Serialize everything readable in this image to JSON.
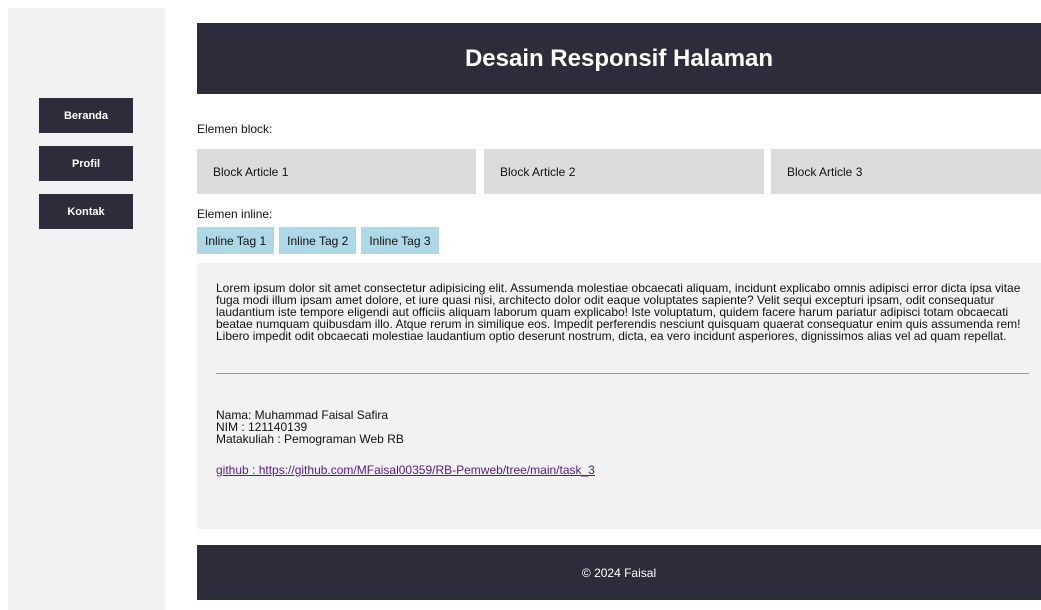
{
  "sidebar": {
    "items": [
      {
        "label": "Beranda"
      },
      {
        "label": "Profil"
      },
      {
        "label": "Kontak"
      }
    ]
  },
  "header": {
    "title": "Desain Responsif Halaman"
  },
  "block_section": {
    "label": "Elemen block:",
    "articles": [
      "Block Article 1",
      "Block Article 2",
      "Block Article 3"
    ]
  },
  "inline_section": {
    "label": "Elemen inline:",
    "tags": [
      "Inline Tag 1",
      "Inline Tag 2",
      "Inline Tag 3"
    ]
  },
  "content": {
    "paragraph": "Lorem ipsum dolor sit amet consectetur adipisicing elit. Assumenda molestiae obcaecati aliquam, incidunt explicabo omnis adipisci error dicta ipsa vitae fuga modi illum ipsam amet dolore, et iure quasi nisi, architecto dolor odit eaque voluptates sapiente? Velit sequi excepturi ipsam, odit consequatur laudantium iste tempore eligendi aut officiis aliquam laborum quam explicabo! Iste voluptatum, quidem facere harum pariatur adipisci totam obcaecati beatae numquam quibusdam illo. Atque rerum in similique eos. Impedit perferendis nesciunt quisquam quaerat consequatur enim quis assumenda rem! Libero impedit odit obcaecati molestiae laudantium optio deserunt nostrum, dicta, ea vero incidunt asperiores, dignissimos alias vel ad quam repellat.",
    "nama": "Nama: Muhammad Faisal Safira",
    "nim": "NIM : 121140139",
    "matakuliah": "Matakuliah : Pemograman Web RB",
    "github": "github : https://github.com/MFaisal00359/RB-Pemweb/tree/main/task_3"
  },
  "footer": {
    "text": "© 2024 Faisal"
  },
  "colors": {
    "dark": "#2c2c3a",
    "sidebar_bg": "#f2f2f2",
    "block_bg": "#dcdcdc",
    "inline_bg": "#add8e6",
    "link": "#551a8b"
  }
}
